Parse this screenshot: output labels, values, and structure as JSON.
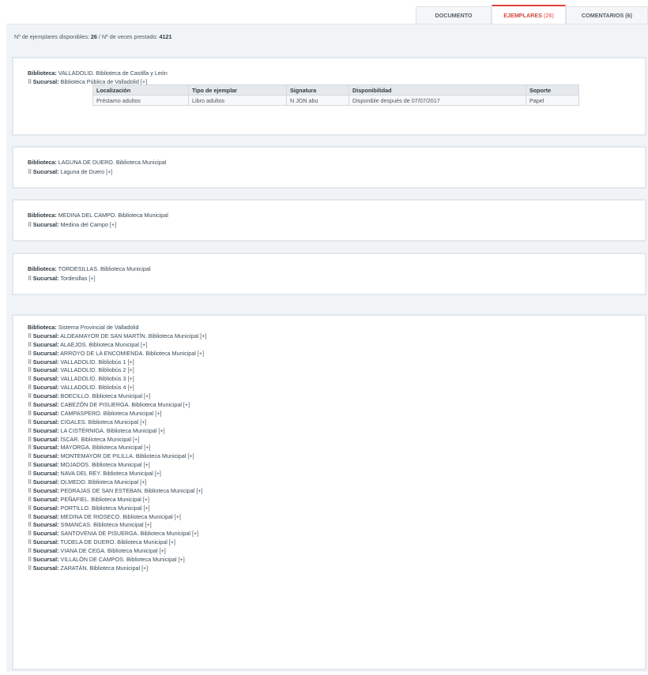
{
  "tabs": {
    "documento": "DOCUMENTO",
    "ejemplares": "EJEMPLARES",
    "ejemplares_count": "(26)",
    "comentarios": "COMENTARIOS (6)"
  },
  "summary": {
    "disponibles_label": "Nº de ejemplares disponibles:",
    "disponibles_value": "26",
    "separator": "/",
    "prestado_label": "Nº de veces prestado:",
    "prestado_value": "4121"
  },
  "labels": {
    "biblioteca": "Biblioteca:",
    "sucursal": "Sucursal:",
    "plus": "[+]"
  },
  "cards": [
    {
      "biblioteca": "VALLADOLID. Biblioteca de Castilla y León",
      "sucursal": "Biblioteca Pública de Valladolid",
      "table": {
        "headers": [
          "Localización",
          "Tipo de ejemplar",
          "Signatura",
          "Disponibilidad",
          "Soporte"
        ],
        "rows": [
          [
            "Préstamo adultos",
            "Libro adultos",
            "N JON abu",
            "Disponible después de 07/07/2017",
            "Papel"
          ]
        ]
      }
    },
    {
      "biblioteca": "LAGUNA DE DUERO. Biblioteca Municipal",
      "sucursal": "Laguna de Duero"
    },
    {
      "biblioteca": "MEDINA DEL CAMPO. Biblioteca Municipal",
      "sucursal": "Medina del Campo"
    },
    {
      "biblioteca": "TORDESILLAS. Biblioteca Municipal",
      "sucursal": "Tordesillas"
    }
  ],
  "provincial": {
    "biblioteca": "Sistema Provincial de Valladolid",
    "sucursales": [
      "ALDEAMAYOR DE SAN MARTÍN. Biblioteca Municipal",
      "ALAEJOS. Biblioteca Municipal",
      "ARROYO DE LA ENCOMIENDA. Biblioteca Municipal",
      "VALLADOLID. Bibliobús 1",
      "VALLADOLID. Bibliobús 2",
      "VALLADOLID. Bibliobús 3",
      "VALLADOLID. Bibliobús 4",
      "BOECILLO. Biblioteca Municipal",
      "CABEZÓN DE PISUERGA. Biblioteca Municipal",
      "CAMPASPERO. Biblioteca Municipal",
      "CIGALES. Biblioteca Municipal",
      "LA CISTÉRNIGA. Biblioteca Municipal",
      "ÍSCAR. Biblioteca Municipal",
      "MAYORGA. Biblioteca Municipal",
      "MONTEMAYOR DE PILILLA. Biblioteca Municipal",
      "MOJADOS. Biblioteca Municipal",
      "NAVA DEL REY. Biblioteca Municipal",
      "OLMEDO. Biblioteca Municipal",
      "PEDRAJAS DE SAN ESTEBAN. Biblioteca Municipal",
      "PEÑAFIEL. Biblioteca Municipal",
      "PORTILLO. Biblioteca Municipal",
      "MEDINA DE RIOSECO. Biblioteca Municipal",
      "SIMANCAS. Biblioteca Municipal",
      "SANTOVENIA DE PISUERGA. Biblioteca Municipal",
      "TUDELA DE DUERO. Biblioteca Municipal",
      "VIANA DE CEGA. Biblioteca Municipal",
      "VILLALÓN DE CAMPOS. Biblioteca Municipal",
      "ZARATÁN. Biblioteca Municipal"
    ]
  }
}
